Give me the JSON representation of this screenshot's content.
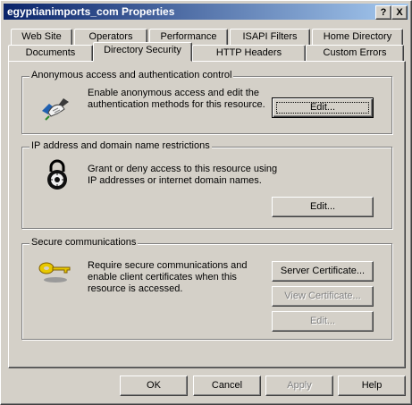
{
  "window": {
    "title": "egyptianimports_com Properties",
    "help_label": "?",
    "close_label": "X"
  },
  "tabs": {
    "row_back": [
      "Web Site",
      "Operators",
      "Performance",
      "ISAPI Filters",
      "Home Directory"
    ],
    "row_front": [
      "Documents",
      "Directory Security",
      "HTTP Headers",
      "Custom Errors"
    ],
    "active": "Directory Security"
  },
  "anonymous": {
    "legend": "Anonymous access and authentication control",
    "line1": "Enable anonymous access and edit the",
    "line2": "authentication methods for this resource.",
    "edit_label": "Edit...",
    "icon": "handshake-icon"
  },
  "ip": {
    "legend": "IP address and domain name restrictions",
    "line1": "Grant or deny access to this resource using",
    "line2": "IP addresses or internet domain names.",
    "edit_label": "Edit...",
    "icon": "lock-icon"
  },
  "secure": {
    "legend": "Secure communications",
    "line1": "Require secure communications and",
    "line2": "enable client certificates when this",
    "line3": "resource is accessed.",
    "server_cert_label": "Server Certificate...",
    "view_cert_label": "View Certificate...",
    "edit_label": "Edit...",
    "icon": "key-icon"
  },
  "footer": {
    "ok_label": "OK",
    "cancel_label": "Cancel",
    "apply_label": "Apply",
    "help_label": "Help"
  },
  "colors": {
    "title_start": "#0a246a",
    "title_end": "#a6caf0",
    "face": "#d4d0c8"
  }
}
